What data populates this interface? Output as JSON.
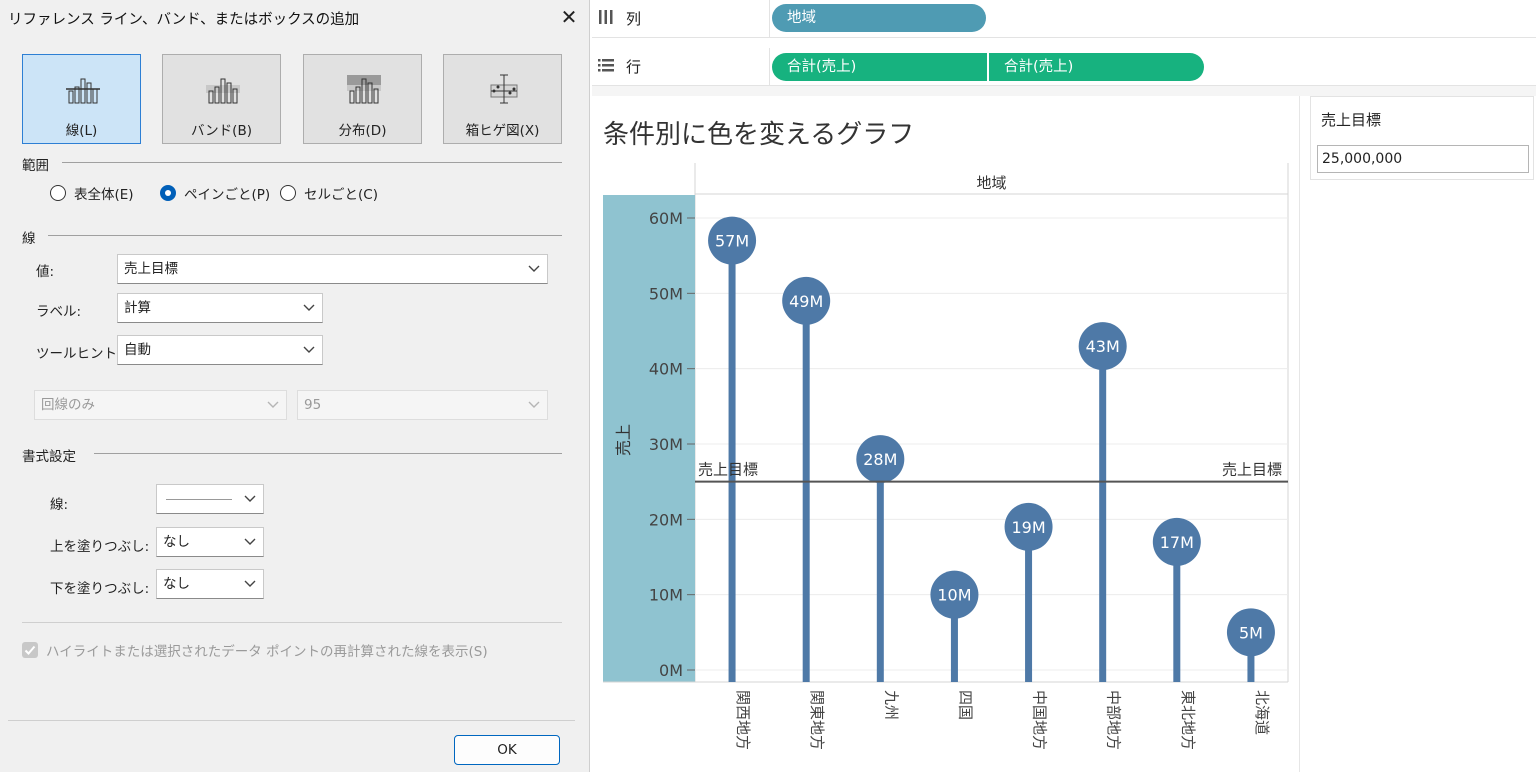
{
  "dialog": {
    "title": "リファレンス ライン、バンド、またはボックスの追加",
    "close_glyph": "✕",
    "types": [
      {
        "label": "線(L)",
        "icon": "line-chart-icon",
        "active": true
      },
      {
        "label": "バンド(B)",
        "icon": "band-chart-icon",
        "active": false
      },
      {
        "label": "分布(D)",
        "icon": "distribution-chart-icon",
        "active": false
      },
      {
        "label": "箱ヒゲ図(X)",
        "icon": "box-plot-icon",
        "active": false
      }
    ],
    "scope": {
      "heading": "範囲",
      "options": [
        {
          "label": "表全体(E)",
          "selected": false
        },
        {
          "label": "ペインごと(P)",
          "selected": true
        },
        {
          "label": "セルごと(C)",
          "selected": false
        }
      ]
    },
    "line": {
      "heading": "線",
      "value_label": "値:",
      "value": "売上目標",
      "label_label": "ラベル:",
      "label_value": "計算",
      "tooltip_label": "ツールヒント:",
      "tooltip_value": "自動",
      "confidence_mode": "回線のみ",
      "confidence_level": "95"
    },
    "format": {
      "heading": "書式設定",
      "line_label": "線:",
      "fill_above_label": "上を塗りつぶし:",
      "fill_above_value": "なし",
      "fill_below_label": "下を塗りつぶし:",
      "fill_below_value": "なし"
    },
    "highlight_checkbox": {
      "label": "ハイライトまたは選択されたデータ ポイントの再計算された線を表示(S)",
      "checked": true,
      "disabled": true
    },
    "ok_label": "OK"
  },
  "shelves": {
    "columns": {
      "label": "列",
      "icon": "columns-icon",
      "pills": [
        "地域"
      ]
    },
    "rows": {
      "label": "行",
      "icon": "rows-icon",
      "pills": [
        "合計(売上)",
        "合計(売上)"
      ]
    }
  },
  "parameter": {
    "title": "売上目標",
    "value": "25,000,000"
  },
  "colors": {
    "lollipop": "#4e79a7",
    "axis_band": "#8fc3d0",
    "reference_line": "#555555",
    "dimension_pill": "#4f9bb3",
    "measure_pill": "#17b27f",
    "active_button": "#cce4f7"
  },
  "chart_data": {
    "type": "bar",
    "title": "条件別に色を変えるグラフ",
    "column_header": "地域",
    "ylabel": "売上",
    "ylim": [
      0,
      62000000
    ],
    "y_ticks": [
      0,
      10000000,
      20000000,
      30000000,
      40000000,
      50000000,
      60000000
    ],
    "y_tick_labels": [
      "0M",
      "10M",
      "20M",
      "30M",
      "40M",
      "50M",
      "60M"
    ],
    "categories": [
      "関西地方",
      "関東地方",
      "九州",
      "四国",
      "中国地方",
      "中部地方",
      "東北地方",
      "北海道"
    ],
    "values": [
      57000000,
      49000000,
      28000000,
      10000000,
      19000000,
      43000000,
      17000000,
      5000000
    ],
    "value_labels": [
      "57M",
      "49M",
      "28M",
      "10M",
      "19M",
      "43M",
      "17M",
      "5M"
    ],
    "reference_line": {
      "value": 25000000,
      "label": "売上目標"
    },
    "grid": true
  }
}
